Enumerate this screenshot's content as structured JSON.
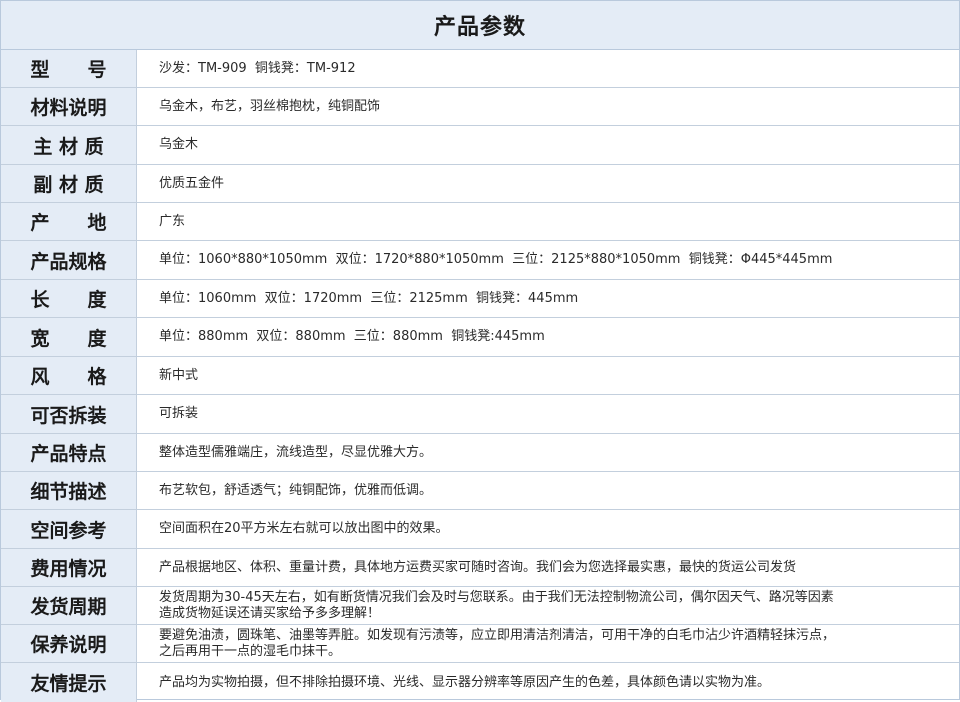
{
  "title": "产品参数",
  "rows": [
    {
      "label": "型　　号",
      "value": "沙发：TM-909  铜钱凳：TM-912"
    },
    {
      "label": "材料说明",
      "value": "乌金木，布艺，羽丝棉抱枕，纯铜配饰"
    },
    {
      "label": "主 材 质",
      "value": "乌金木"
    },
    {
      "label": "副 材 质",
      "value": "优质五金件"
    },
    {
      "label": "产　　地",
      "value": "广东"
    },
    {
      "label": "产品规格",
      "value": "单位：1060*880*1050mm  双位：1720*880*1050mm  三位：2125*880*1050mm  铜钱凳：Φ445*445mm"
    },
    {
      "label": "长　　度",
      "value": "单位：1060mm  双位：1720mm  三位：2125mm  铜钱凳：445mm"
    },
    {
      "label": "宽　　度",
      "value": "单位：880mm  双位：880mm  三位：880mm  铜钱凳:445mm"
    },
    {
      "label": "风　　格",
      "value": "新中式"
    },
    {
      "label": "可否拆装",
      "value": "可拆装"
    },
    {
      "label": "产品特点",
      "value": "整体造型儒雅端庄，流线造型，尽显优雅大方。"
    },
    {
      "label": "细节描述",
      "value": "布艺软包，舒适透气；纯铜配饰，优雅而低调。"
    },
    {
      "label": "空间参考",
      "value": "空间面积在20平方米左右就可以放出图中的效果。"
    },
    {
      "label": "费用情况",
      "value": "产品根据地区、体积、重量计费，具体地方运费买家可随时咨询。我们会为您选择最实惠，最快的货运公司发货"
    },
    {
      "label": "发货周期",
      "value": "发货周期为30-45天左右，如有断货情况我们会及时与您联系。由于我们无法控制物流公司，偶尔因天气、路况等因素\n造成货物延误还请买家给予多多理解！"
    },
    {
      "label": "保养说明",
      "value": "要避免油渍，圆珠笔、油墨等弄脏。如发现有污渍等，应立即用清洁剂清洁，可用干净的白毛巾沾少许酒精轻抹污点，\n之后再用干一点的湿毛巾抹干。"
    },
    {
      "label": "友情提示",
      "value": "产品均为实物拍摄，但不排除拍摄环境、光线、显示器分辨率等原因产生的色差，具体颜色请以实物为准。"
    }
  ]
}
